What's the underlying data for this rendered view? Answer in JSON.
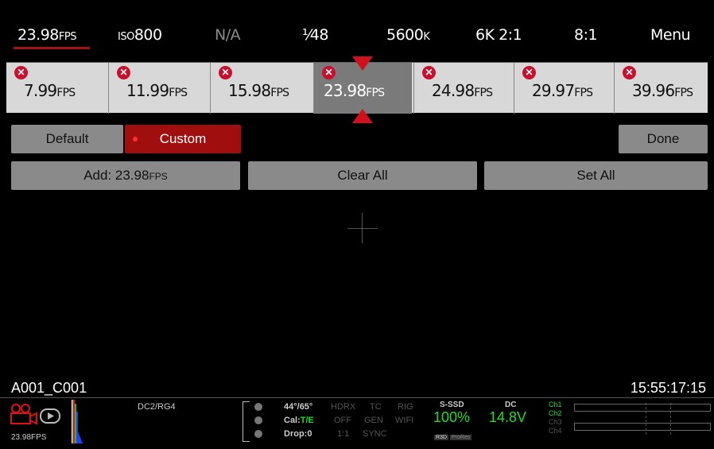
{
  "topbar": {
    "fps_value": "23.98",
    "fps_unit": "FPS",
    "iso_prefix": "ISO",
    "iso_value": "800",
    "na": "N/A",
    "shutter": "¹⁄48",
    "white_balance": "5600",
    "wb_unit": "K",
    "resolution": "6K 2:1",
    "compression": "8:1",
    "menu": "Menu"
  },
  "presets": [
    {
      "value": "7.99",
      "unit": "FPS",
      "selected": false
    },
    {
      "value": "11.99",
      "unit": "FPS",
      "selected": false
    },
    {
      "value": "15.98",
      "unit": "FPS",
      "selected": false
    },
    {
      "value": "23.98",
      "unit": "FPS",
      "selected": true
    },
    {
      "value": "24.98",
      "unit": "FPS",
      "selected": false
    },
    {
      "value": "29.97",
      "unit": "FPS",
      "selected": false
    },
    {
      "value": "39.96",
      "unit": "FPS",
      "selected": false
    }
  ],
  "controls": {
    "default_label": "Default",
    "custom_label": "Custom",
    "done_label": "Done",
    "add_label": "Add: 23.98",
    "add_unit": "FPS",
    "clear_all_label": "Clear All",
    "set_all_label": "Set All"
  },
  "overlay": {
    "clip_name": "A001_C001",
    "timecode": "15:55:17:15"
  },
  "bottombar": {
    "fps": "23.98FPS",
    "look": "DC2/RG4",
    "temp": "44°/65°",
    "cal_prefix": "Cal:",
    "cal_value": "T/E",
    "drop": "Drop:0",
    "hdrx": "HDRX",
    "hdrx_value": "OFF",
    "hdrx_ratio": "1:1",
    "tc": "TC",
    "tc_gen": "GEN",
    "tc_sync": "SYNC",
    "rig": "RIG",
    "rig_wifi": "WIFI",
    "media_label": "S-SSD",
    "media_value": "100%",
    "media_badge_1": "R3D",
    "media_badge_2": "ProRes",
    "power_label": "DC",
    "power_value": "14.8V",
    "ch1": "Ch1",
    "ch2": "Ch2",
    "ch3": "Ch3",
    "ch4": "Ch4"
  },
  "colors": {
    "accent_red": "#a00e0e",
    "marker_red": "#d1101e",
    "status_green": "#22dd22"
  },
  "icons": [
    "camera-icon",
    "play-icon",
    "close-icon"
  ]
}
